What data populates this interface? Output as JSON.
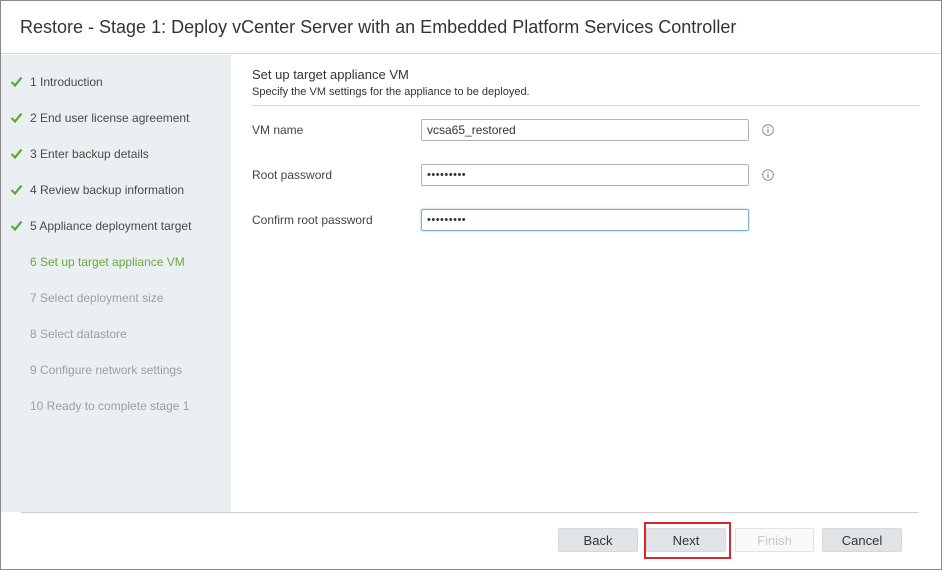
{
  "window": {
    "title": "Restore - Stage 1: Deploy vCenter Server with an Embedded Platform Services Controller"
  },
  "steps": [
    {
      "label": "1 Introduction",
      "status": "done"
    },
    {
      "label": "2 End user license agreement",
      "status": "done"
    },
    {
      "label": "3 Enter backup details",
      "status": "done"
    },
    {
      "label": "4 Review backup information",
      "status": "done"
    },
    {
      "label": "5 Appliance deployment target",
      "status": "done"
    },
    {
      "label": "6 Set up target appliance VM",
      "status": "current"
    },
    {
      "label": "7 Select deployment size",
      "status": "future"
    },
    {
      "label": "8 Select datastore",
      "status": "future"
    },
    {
      "label": "9 Configure network settings",
      "status": "future"
    },
    {
      "label": "10 Ready to complete stage 1",
      "status": "future"
    }
  ],
  "page": {
    "heading": "Set up target appliance VM",
    "subheading": "Specify the VM settings for the appliance to be deployed."
  },
  "form": {
    "vm_name": {
      "label": "VM name",
      "value": "vcsa65_restored"
    },
    "root_password": {
      "label": "Root password",
      "value": "•••••••••"
    },
    "confirm_password": {
      "label": "Confirm root password",
      "value": "•••••••••"
    }
  },
  "buttons": {
    "back": "Back",
    "next": "Next",
    "finish": "Finish",
    "cancel": "Cancel"
  },
  "icons": {
    "check": "check-icon",
    "info": "info-icon"
  },
  "colors": {
    "sidebar_bg": "#eaeff1",
    "check_green": "#5ca83a",
    "current_step": "#6aab3a",
    "future_step": "#9aa0a3",
    "highlight": "#d9252c"
  }
}
